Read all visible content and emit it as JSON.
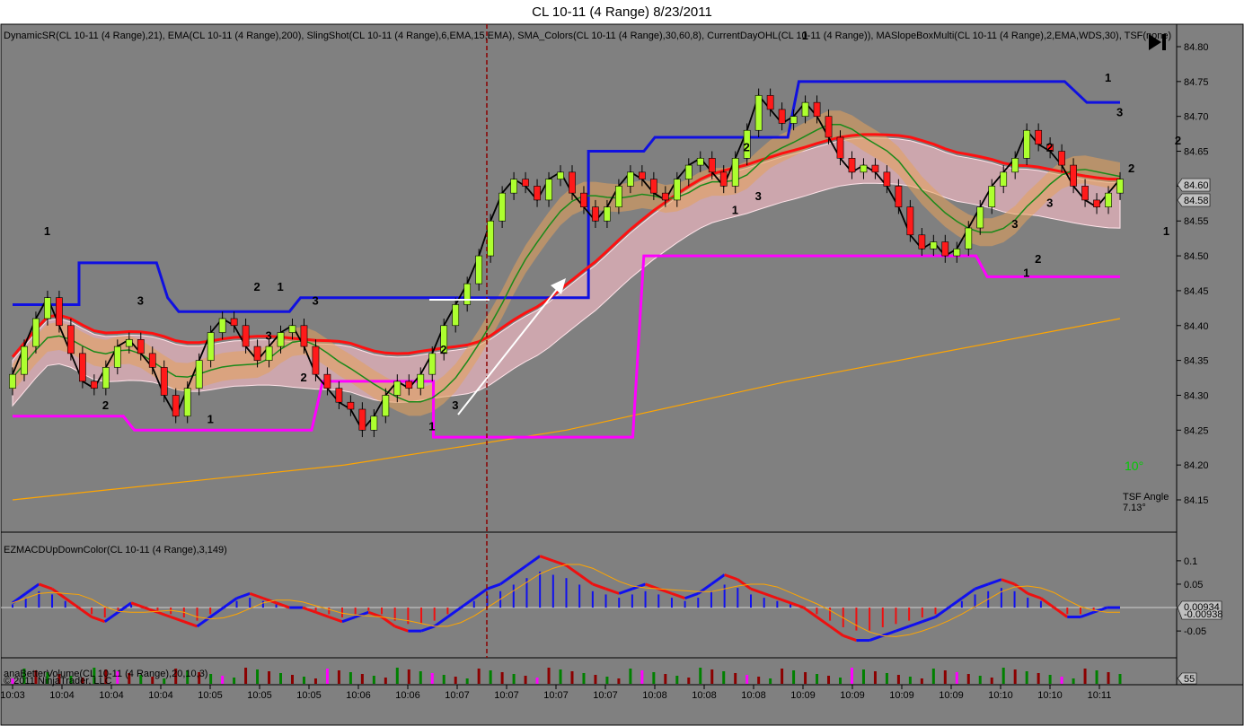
{
  "window": {
    "title": "CL 10-11 (4 Range)  8/23/2011"
  },
  "colors": {
    "background": "#808080",
    "up_bar": "#adff2f",
    "down_bar": "#ff1a1a",
    "sr_line": "#1010e0",
    "magenta_line": "#ff00ff",
    "ema200": "#ffa500",
    "band": "#ffc0cb",
    "orange_band": "#e6a05a",
    "red_line": "#ff1010",
    "macd_up": "#1010ee",
    "macd_down": "#ee1010",
    "vol_green": "#008000",
    "vol_red": "#8b0000",
    "vol_magenta": "#ff00ff"
  },
  "price_panel": {
    "indicators_label": "DynamicSR(CL 10-11 (4 Range),21), EMA(CL 10-11 (4 Range),200), SlingShot(CL 10-11 (4 Range),6,EMA,15,EMA), SMA_Colors(CL 10-11 (4 Range),30,60,8), CurrentDayOHL(CL 10-11 (4 Range)), MASlopeBoxMulti(CL 10-11 (4 Range),2,EMA,WDS,30), TSF(none)",
    "angle_text": "10°",
    "tsf_label": "TSF Angle",
    "tsf_value": "7.13°",
    "price_tag_1": "84.60",
    "price_tag_2": "84.58",
    "play_icon": "skip-forward-icon"
  },
  "macd_panel": {
    "label": "EZMACDUpDownColor(CL 10-11 (4 Range),3,149)",
    "value_tag_1": "0.00934",
    "value_tag_2": "-0.00938"
  },
  "volume_panel": {
    "label": "anaBetterVolume(CL 10-11 (4 Range),20,10,3)",
    "value_tag": "55",
    "copyright": "© 2011 NinjaTrader, LLC"
  },
  "chart_data": [
    {
      "type": "candlestick",
      "title": "CL 10-11 (4 Range)  8/23/2011",
      "ylim": [
        84.1,
        84.82
      ],
      "y_ticks": [
        84.15,
        84.2,
        84.25,
        84.3,
        84.35,
        84.4,
        84.45,
        84.5,
        84.55,
        84.6,
        84.65,
        84.7,
        84.75,
        84.8
      ],
      "x_labels": [
        "10:03",
        "10:04",
        "10:04",
        "10:04",
        "10:05",
        "10:05",
        "10:05",
        "10:06",
        "10:06",
        "10:07",
        "10:07",
        "10:07",
        "10:07",
        "10:08",
        "10:08",
        "10:08",
        "10:09",
        "10:09",
        "10:09",
        "10:09",
        "10:10",
        "10:10",
        "10:11"
      ],
      "closes": [
        84.33,
        84.37,
        84.41,
        84.44,
        84.4,
        84.36,
        84.32,
        84.31,
        84.34,
        84.37,
        84.38,
        84.36,
        84.34,
        84.3,
        84.27,
        84.31,
        84.35,
        84.39,
        84.41,
        84.4,
        84.37,
        84.35,
        84.37,
        84.39,
        84.4,
        84.37,
        84.33,
        84.31,
        84.29,
        84.28,
        84.25,
        84.27,
        84.3,
        84.32,
        84.31,
        84.33,
        84.36,
        84.4,
        84.43,
        84.46,
        84.5,
        84.55,
        84.59,
        84.61,
        84.6,
        84.58,
        84.61,
        84.62,
        84.59,
        84.57,
        84.55,
        84.57,
        84.6,
        84.62,
        84.61,
        84.59,
        84.58,
        84.61,
        84.63,
        84.64,
        84.62,
        84.6,
        84.64,
        84.68,
        84.73,
        84.71,
        84.69,
        84.7,
        84.72,
        84.7,
        84.67,
        84.64,
        84.62,
        84.63,
        84.62,
        84.6,
        84.57,
        84.53,
        84.51,
        84.52,
        84.5,
        84.51,
        84.54,
        84.57,
        84.6,
        84.62,
        84.64,
        84.68,
        84.66,
        84.65,
        84.63,
        84.6,
        84.58,
        84.57,
        84.59,
        84.61
      ],
      "sr_line": [
        [
          0,
          84.43
        ],
        [
          6,
          84.43
        ],
        [
          6,
          84.49
        ],
        [
          13,
          84.49
        ],
        [
          14,
          84.44
        ],
        [
          15,
          84.42
        ],
        [
          25,
          84.42
        ],
        [
          26,
          84.44
        ],
        [
          52,
          84.44
        ],
        [
          52,
          84.65
        ],
        [
          57,
          84.65
        ],
        [
          58,
          84.67
        ],
        [
          70,
          84.67
        ],
        [
          71,
          84.75
        ],
        [
          95,
          84.75
        ],
        [
          97,
          84.72
        ],
        [
          100,
          84.72
        ]
      ],
      "magenta_line": [
        [
          0,
          84.27
        ],
        [
          10,
          84.27
        ],
        [
          11,
          84.25
        ],
        [
          27,
          84.25
        ],
        [
          28,
          84.32
        ],
        [
          38,
          84.32
        ],
        [
          38,
          84.24
        ],
        [
          56,
          84.24
        ],
        [
          57,
          84.5
        ],
        [
          87,
          84.5
        ],
        [
          88,
          84.47
        ],
        [
          100,
          84.47
        ]
      ],
      "ema200": [
        [
          0,
          84.15
        ],
        [
          30,
          84.2
        ],
        [
          50,
          84.25
        ],
        [
          70,
          84.32
        ],
        [
          90,
          84.38
        ],
        [
          100,
          84.41
        ]
      ],
      "swing_labels": [
        {
          "i": 3,
          "v": 84.53,
          "t": "1"
        },
        {
          "i": 8,
          "v": 84.28,
          "t": "2"
        },
        {
          "i": 11,
          "v": 84.43,
          "t": "3"
        },
        {
          "i": 17,
          "v": 84.26,
          "t": "1"
        },
        {
          "i": 21,
          "v": 84.45,
          "t": "2"
        },
        {
          "i": 23,
          "v": 84.45,
          "t": "1"
        },
        {
          "i": 22,
          "v": 84.38,
          "t": "3"
        },
        {
          "i": 26,
          "v": 84.43,
          "t": "3"
        },
        {
          "i": 25,
          "v": 84.32,
          "t": "2"
        },
        {
          "i": 36,
          "v": 84.25,
          "t": "1"
        },
        {
          "i": 37,
          "v": 84.36,
          "t": "2"
        },
        {
          "i": 38,
          "v": 84.28,
          "t": "3"
        },
        {
          "i": 62,
          "v": 84.56,
          "t": "1"
        },
        {
          "i": 64,
          "v": 84.58,
          "t": "3"
        },
        {
          "i": 63,
          "v": 84.65,
          "t": "2"
        },
        {
          "i": 68,
          "v": 84.81,
          "t": "1"
        },
        {
          "i": 88,
          "v": 84.49,
          "t": "2"
        },
        {
          "i": 86,
          "v": 84.54,
          "t": "3"
        },
        {
          "i": 87,
          "v": 84.47,
          "t": "1"
        },
        {
          "i": 89,
          "v": 84.65,
          "t": "2"
        },
        {
          "i": 89,
          "v": 84.57,
          "t": "3"
        },
        {
          "i": 94,
          "v": 84.75,
          "t": "1"
        },
        {
          "i": 95,
          "v": 84.7,
          "t": "3"
        },
        {
          "i": 96,
          "v": 84.62,
          "t": "2"
        },
        {
          "i": 99,
          "v": 84.53,
          "t": "1"
        },
        {
          "i": 100,
          "v": 84.66,
          "t": "2"
        }
      ]
    },
    {
      "type": "bar",
      "title": "EZMACDUpDownColor(CL 10-11 (4 Range),3,149)",
      "ylim": [
        -0.09,
        0.14
      ],
      "y_ticks": [
        -0.05,
        0.05,
        0.1
      ],
      "macd_line": [
        0.01,
        0.03,
        0.05,
        0.04,
        0.02,
        0.0,
        -0.02,
        -0.03,
        -0.01,
        0.01,
        0.0,
        -0.01,
        -0.02,
        -0.03,
        -0.04,
        -0.02,
        0.0,
        0.02,
        0.03,
        0.02,
        0.01,
        0.0,
        0.0,
        -0.01,
        -0.02,
        -0.03,
        -0.02,
        -0.01,
        -0.02,
        -0.04,
        -0.05,
        -0.05,
        -0.04,
        -0.02,
        0.0,
        0.02,
        0.04,
        0.05,
        0.07,
        0.09,
        0.11,
        0.1,
        0.09,
        0.07,
        0.05,
        0.04,
        0.03,
        0.04,
        0.05,
        0.04,
        0.03,
        0.02,
        0.03,
        0.05,
        0.07,
        0.06,
        0.04,
        0.03,
        0.02,
        0.01,
        0.0,
        -0.02,
        -0.04,
        -0.06,
        -0.07,
        -0.07,
        -0.06,
        -0.05,
        -0.04,
        -0.03,
        -0.02,
        0.0,
        0.02,
        0.04,
        0.05,
        0.06,
        0.05,
        0.03,
        0.02,
        0.0,
        -0.02,
        -0.02,
        -0.01,
        0.0,
        0.0
      ]
    },
    {
      "type": "bar",
      "title": "anaBetterVolume(CL 10-11 (4 Range),20,10,3)",
      "value_tag": "55"
    }
  ]
}
